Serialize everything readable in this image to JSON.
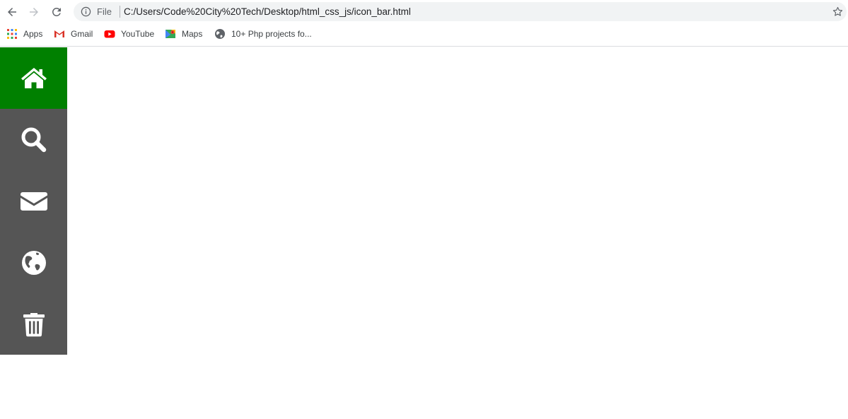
{
  "browser": {
    "scheme_label": "File",
    "url": "C:/Users/Code%20City%20Tech/Desktop/html_css_js/icon_bar.html",
    "icons": {
      "back": "arrow-left-icon",
      "forward": "arrow-right-icon",
      "reload": "reload-icon",
      "info": "info-icon",
      "bookmark_star": "star-icon"
    }
  },
  "bookmarks": [
    {
      "label": "Apps",
      "icon": "apps-grid-icon"
    },
    {
      "label": "Gmail",
      "icon": "gmail-icon"
    },
    {
      "label": "YouTube",
      "icon": "youtube-icon"
    },
    {
      "label": "Maps",
      "icon": "maps-icon"
    },
    {
      "label": "10+ Php projects fo...",
      "icon": "globe-icon"
    }
  ],
  "icon_bar": {
    "active_color": "#008000",
    "background_color": "#555555",
    "items": [
      {
        "icon": "home-icon",
        "active": true
      },
      {
        "icon": "search-icon",
        "active": false
      },
      {
        "icon": "envelope-icon",
        "active": false
      },
      {
        "icon": "globe-icon",
        "active": false
      },
      {
        "icon": "trash-icon",
        "active": false
      }
    ]
  }
}
